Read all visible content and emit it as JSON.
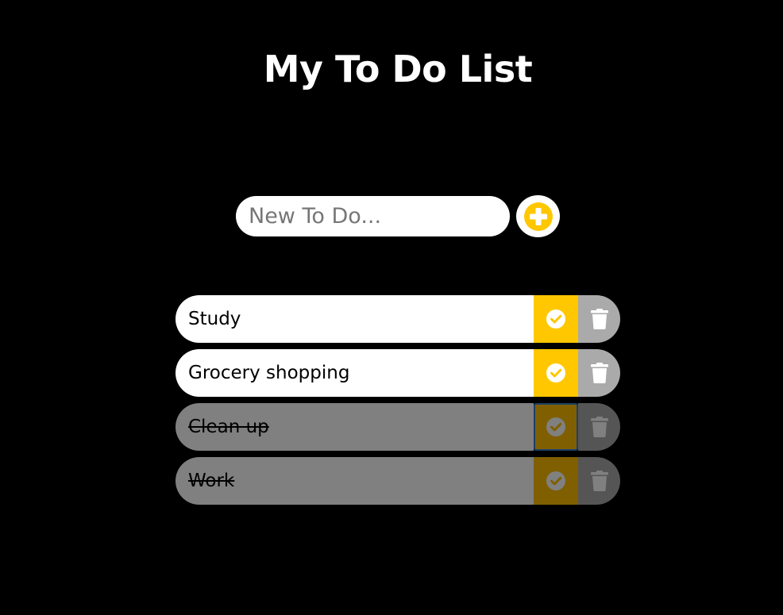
{
  "header": {
    "title": "My To Do List"
  },
  "new_todo": {
    "placeholder": "New To Do...",
    "value": "",
    "add_icon": "plus-circle-icon"
  },
  "todos": [
    {
      "text": "Study",
      "completed": false
    },
    {
      "text": "Grocery shopping",
      "completed": false
    },
    {
      "text": "Clean up",
      "completed": true
    },
    {
      "text": "Work",
      "completed": true
    }
  ],
  "icons": {
    "complete": "check-circle-icon",
    "delete": "trash-icon"
  },
  "colors": {
    "background": "#000000",
    "accent": "#ffc700",
    "delete": "#aaaaaa",
    "completed_item": "#808080"
  }
}
